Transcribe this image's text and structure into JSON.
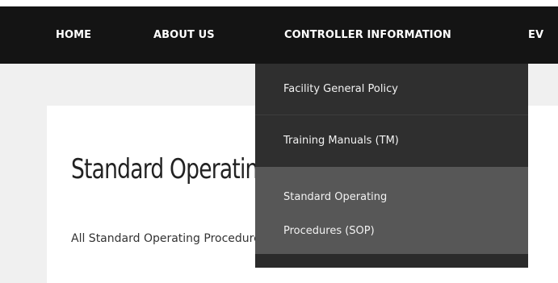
{
  "nav": {
    "items": [
      {
        "label": "HOME"
      },
      {
        "label": "ABOUT US"
      },
      {
        "label": "CONTROLLER INFORMATION"
      },
      {
        "label": "EV"
      }
    ]
  },
  "dropdown": {
    "items": [
      {
        "label": "Facility General Policy"
      },
      {
        "label": "Training Manuals (TM)"
      },
      {
        "label_line1": "Standard Operating",
        "label_line2": "Procedures (SOP)"
      }
    ]
  },
  "main": {
    "heading": "Standard Operating Procedures (SOP)",
    "body_text": "All Standard Operating Procedures (SOP) are listed below."
  },
  "colors": {
    "navbar": "#141414",
    "dropdown": "#2f2f2f",
    "dropdown_active": "#575757",
    "page_background": "#f0f0f0",
    "card": "#ffffff"
  }
}
